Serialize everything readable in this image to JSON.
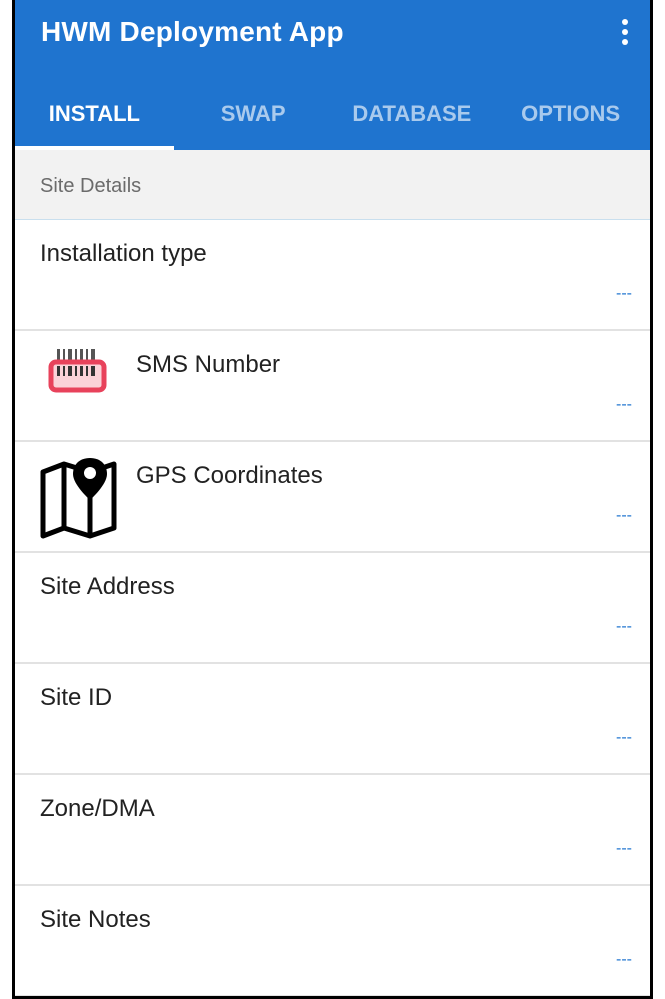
{
  "app": {
    "title": "HWM Deployment App"
  },
  "tabs": [
    {
      "label": "INSTALL",
      "active": true
    },
    {
      "label": "SWAP",
      "active": false
    },
    {
      "label": "DATABASE",
      "active": false
    },
    {
      "label": "OPTIONS",
      "active": false
    }
  ],
  "section": {
    "title": "Site Details"
  },
  "fields": [
    {
      "label": "Installation type",
      "value": "---"
    },
    {
      "label": "SMS Number",
      "value": "---",
      "icon": "barcode-scanner-icon"
    },
    {
      "label": "GPS Coordinates",
      "value": "---",
      "icon": "map-pin-icon"
    },
    {
      "label": "Site Address",
      "value": "---"
    },
    {
      "label": "Site ID",
      "value": "---"
    },
    {
      "label": "Zone/DMA",
      "value": "---"
    },
    {
      "label": "Site Notes",
      "value": "---"
    }
  ],
  "colors": {
    "accent": "#1f74cf",
    "scanner": "#e8425b"
  }
}
